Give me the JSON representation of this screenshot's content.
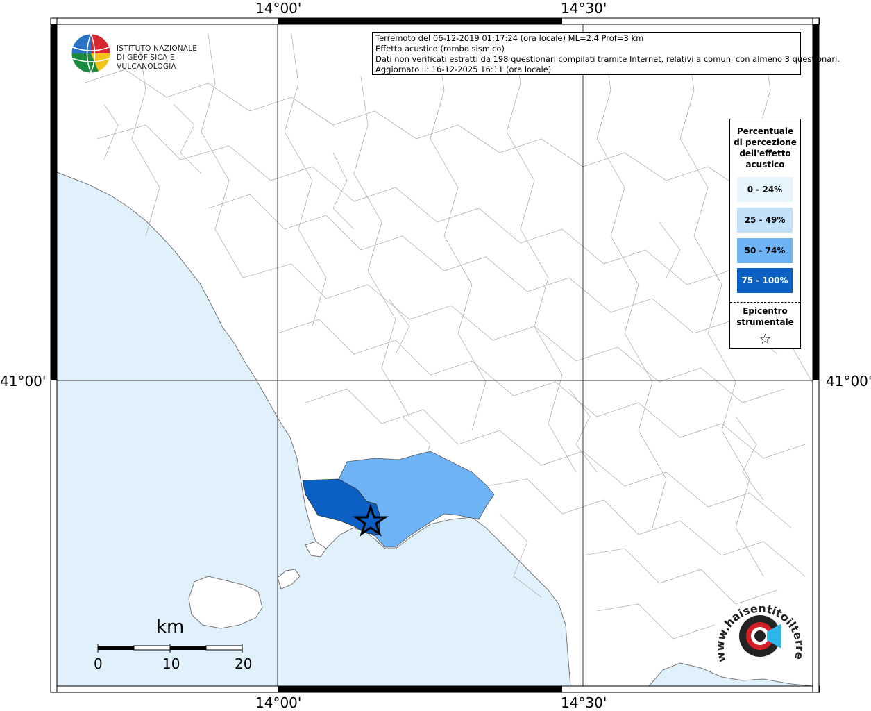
{
  "map": {
    "lon_ticks": [
      "14°00'",
      "14°30'"
    ],
    "lat_ticks": [
      "41°00'"
    ]
  },
  "info": {
    "line1": "Terremoto del 06-12-2019 01:17:24 (ora locale) ML=2.4 Prof=3 km",
    "line2": "Effetto acustico (rombo sismico)",
    "line3": "Dati non verificati estratti da 198 questionari compilati tramite Internet, relativi a comuni con almeno 3 questionari.",
    "line4": "Aggiornato il: 16-12-2025 16:11 (ora locale)"
  },
  "logo": {
    "line1": "ISTITUTO NAZIONALE",
    "line2": "DI GEOFISICA E VULCANOLOGIA"
  },
  "legend": {
    "title_l1": "Percentuale",
    "title_l2": "di percezione",
    "title_l3": "dell'effetto",
    "title_l4": "acustico",
    "classes": [
      {
        "label": "0 - 24%",
        "color": "#e6f4fd"
      },
      {
        "label": "25 - 49%",
        "color": "#c2e0fa"
      },
      {
        "label": "50 - 74%",
        "color": "#6fb3f7"
      },
      {
        "label": "75 - 100%",
        "color": "#0c60c4"
      }
    ],
    "epicenter_l1": "Epicentro",
    "epicenter_l2": "strumentale",
    "star": "☆"
  },
  "scale": {
    "unit": "km",
    "t0": "0",
    "t1": "10",
    "t2": "20"
  },
  "haisentito": {
    "text": "www.haisentitoilterremoto.it"
  },
  "colors": {
    "sea": "#e0f1fc",
    "border": "#aaaaaa",
    "pct_50_74": "#6fb3f7",
    "pct_75_100": "#0c60c4"
  }
}
